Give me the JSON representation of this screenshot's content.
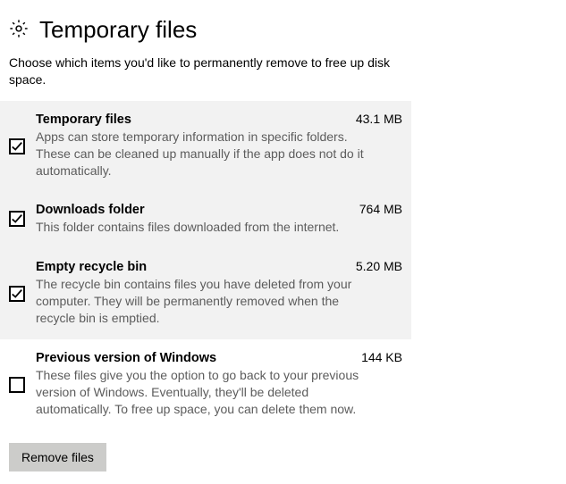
{
  "header": {
    "title": "Temporary files",
    "description": "Choose which items you'd like to permanently remove to free up disk space."
  },
  "items": [
    {
      "title": "Temporary files",
      "size": "43.1 MB",
      "description": "Apps can store temporary information in specific folders. These can be cleaned up manually if the app does not do it automatically.",
      "checked": true,
      "selected": true
    },
    {
      "title": "Downloads folder",
      "size": "764 MB",
      "description": "This folder contains files downloaded from the internet.",
      "checked": true,
      "selected": true
    },
    {
      "title": "Empty recycle bin",
      "size": "5.20 MB",
      "description": "The recycle bin contains files you have deleted from your computer. They will be permanently removed when the recycle bin is emptied.",
      "checked": true,
      "selected": true
    },
    {
      "title": "Previous version of Windows",
      "size": "144 KB",
      "description": "These files give you the option to go back to your previous version of Windows. Eventually, they'll be deleted automatically. To free up space, you can delete them now.",
      "checked": false,
      "selected": false
    }
  ],
  "actions": {
    "remove_label": "Remove files"
  }
}
